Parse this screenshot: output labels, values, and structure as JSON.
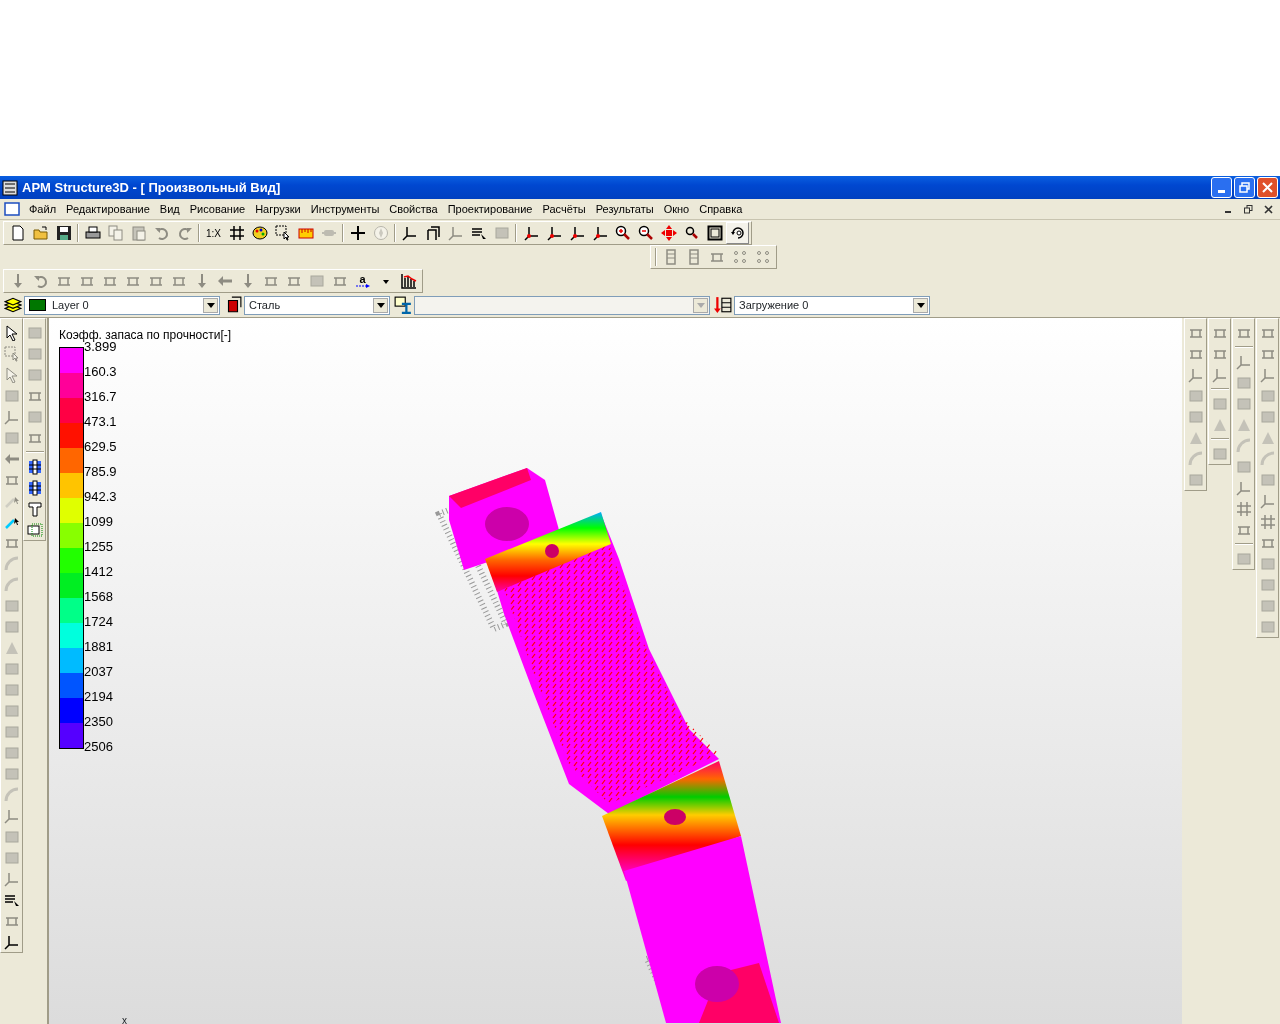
{
  "window": {
    "title": "APM Structure3D - [ Произвольный Вид]"
  },
  "menu": [
    "Файл",
    "Редактирование",
    "Вид",
    "Рисование",
    "Нагрузки",
    "Инструменты",
    "Свойства",
    "Проектирование",
    "Расчёты",
    "Результаты",
    "Окно",
    "Справка"
  ],
  "toolbars": [
    {
      "buttons": [
        {
          "kind": "button",
          "disabled": false,
          "pressed": false
        },
        {
          "kind": "button",
          "disabled": false,
          "pressed": false
        },
        {
          "kind": "button",
          "disabled": false,
          "pressed": false
        },
        {
          "kind": "separator"
        },
        {
          "kind": "button",
          "disabled": false,
          "pressed": false
        },
        {
          "kind": "button",
          "disabled": true,
          "pressed": false
        },
        {
          "kind": "button",
          "disabled": true,
          "pressed": false
        },
        {
          "kind": "button",
          "disabled": true,
          "pressed": false
        },
        {
          "kind": "button",
          "disabled": true,
          "pressed": false
        },
        {
          "kind": "separator"
        },
        {
          "kind": "text",
          "label": "1:X",
          "disabled": false,
          "pressed": false
        },
        {
          "kind": "button",
          "disabled": false,
          "pressed": false
        },
        {
          "kind": "button",
          "disabled": false,
          "pressed": false
        },
        {
          "kind": "button",
          "disabled": false,
          "pressed": false
        },
        {
          "kind": "button",
          "disabled": false,
          "pressed": false
        },
        {
          "kind": "button",
          "disabled": true,
          "pressed": false
        },
        {
          "kind": "separator"
        },
        {
          "kind": "button",
          "disabled": false,
          "pressed": false
        },
        {
          "kind": "button",
          "disabled": true,
          "pressed": false
        },
        {
          "kind": "separator"
        },
        {
          "kind": "button",
          "disabled": false,
          "pressed": false
        },
        {
          "kind": "button",
          "disabled": false,
          "pressed": false
        },
        {
          "kind": "button",
          "disabled": true,
          "pressed": false
        },
        {
          "kind": "button",
          "disabled": false,
          "pressed": false
        },
        {
          "kind": "button",
          "disabled": true,
          "pressed": false
        },
        {
          "kind": "separator"
        },
        {
          "kind": "button",
          "disabled": false,
          "pressed": false
        },
        {
          "kind": "button",
          "disabled": false,
          "pressed": false
        },
        {
          "kind": "button",
          "disabled": false,
          "pressed": false
        },
        {
          "kind": "button",
          "disabled": false,
          "pressed": false
        },
        {
          "kind": "button",
          "disabled": false,
          "pressed": false
        },
        {
          "kind": "button",
          "disabled": false,
          "pressed": false
        },
        {
          "kind": "button",
          "disabled": false,
          "pressed": false
        },
        {
          "kind": "button",
          "disabled": false,
          "pressed": false
        },
        {
          "kind": "button",
          "disabled": false,
          "pressed": false
        },
        {
          "kind": "button",
          "disabled": false,
          "pressed": true
        }
      ]
    },
    {
      "buttons": [
        {
          "kind": "separator"
        },
        {
          "kind": "button",
          "disabled": true
        },
        {
          "kind": "button",
          "disabled": true
        },
        {
          "kind": "button",
          "disabled": true
        },
        {
          "kind": "button",
          "disabled": true
        },
        {
          "kind": "button",
          "disabled": true
        }
      ]
    },
    {
      "buttons": [
        {
          "kind": "button",
          "disabled": true
        },
        {
          "kind": "button",
          "disabled": true
        },
        {
          "kind": "button",
          "disabled": true
        },
        {
          "kind": "button",
          "disabled": true
        },
        {
          "kind": "button",
          "disabled": true
        },
        {
          "kind": "button",
          "disabled": true
        },
        {
          "kind": "button",
          "disabled": true
        },
        {
          "kind": "button",
          "disabled": true
        },
        {
          "kind": "button",
          "disabled": true
        },
        {
          "kind": "button",
          "disabled": true
        },
        {
          "kind": "button",
          "disabled": true
        },
        {
          "kind": "button",
          "disabled": true
        },
        {
          "kind": "button",
          "disabled": true
        },
        {
          "kind": "button",
          "disabled": true
        },
        {
          "kind": "button",
          "disabled": true
        },
        {
          "kind": "text",
          "label": "a",
          "disabled": false
        },
        {
          "kind": "button",
          "disabled": false
        },
        {
          "kind": "button",
          "disabled": false
        }
      ]
    }
  ],
  "property_bar": {
    "layer": {
      "value": "Layer 0",
      "color": "#007700"
    },
    "material": {
      "value": "Сталь"
    },
    "section": {
      "disabled": true
    },
    "load_case": {
      "value": "Загружение 0"
    }
  },
  "side_toolbars": [
    {
      "buttons": [
        {
          "kind": "button",
          "disabled": false
        },
        {
          "kind": "button",
          "disabled": true
        },
        {
          "kind": "button",
          "disabled": true
        },
        {
          "kind": "button",
          "disabled": true
        },
        {
          "kind": "button",
          "disabled": true
        },
        {
          "kind": "button",
          "disabled": true
        },
        {
          "kind": "button",
          "disabled": true
        },
        {
          "kind": "button",
          "disabled": true
        },
        {
          "kind": "button",
          "disabled": true
        },
        {
          "kind": "button",
          "disabled": false
        },
        {
          "kind": "button",
          "disabled": true
        },
        {
          "kind": "button",
          "disabled": true
        },
        {
          "kind": "button",
          "disabled": true
        },
        {
          "kind": "button",
          "disabled": true
        },
        {
          "kind": "button",
          "disabled": true
        },
        {
          "kind": "button",
          "disabled": true
        },
        {
          "kind": "button",
          "disabled": true
        },
        {
          "kind": "button",
          "disabled": true
        },
        {
          "kind": "button",
          "disabled": true
        },
        {
          "kind": "button",
          "disabled": true
        },
        {
          "kind": "button",
          "disabled": true
        },
        {
          "kind": "button",
          "disabled": true
        },
        {
          "kind": "button",
          "disabled": true
        },
        {
          "kind": "button",
          "disabled": true
        },
        {
          "kind": "button",
          "disabled": true
        },
        {
          "kind": "button",
          "disabled": true
        },
        {
          "kind": "button",
          "disabled": true
        },
        {
          "kind": "button",
          "disabled": false
        },
        {
          "kind": "button",
          "disabled": true
        },
        {
          "kind": "button",
          "disabled": false
        }
      ]
    },
    {
      "buttons": [
        {
          "kind": "button",
          "disabled": true
        },
        {
          "kind": "button",
          "disabled": true
        },
        {
          "kind": "button",
          "disabled": true
        },
        {
          "kind": "button",
          "disabled": true
        },
        {
          "kind": "button",
          "disabled": true
        },
        {
          "kind": "button",
          "disabled": true
        },
        {
          "kind": "separator"
        },
        {
          "kind": "button",
          "disabled": false
        },
        {
          "kind": "button",
          "disabled": false
        },
        {
          "kind": "button",
          "disabled": false
        },
        {
          "kind": "button",
          "disabled": false
        }
      ]
    },
    {
      "buttons": [
        {
          "kind": "button",
          "disabled": true
        },
        {
          "kind": "button",
          "disabled": true
        },
        {
          "kind": "button",
          "disabled": true
        },
        {
          "kind": "button",
          "disabled": true
        },
        {
          "kind": "button",
          "disabled": true
        },
        {
          "kind": "button",
          "disabled": true
        },
        {
          "kind": "button",
          "disabled": true
        },
        {
          "kind": "button",
          "disabled": true
        }
      ]
    },
    {
      "buttons": [
        {
          "kind": "button",
          "disabled": true
        },
        {
          "kind": "button",
          "disabled": true
        },
        {
          "kind": "button",
          "disabled": true
        },
        {
          "kind": "separator"
        },
        {
          "kind": "button",
          "disabled": true
        },
        {
          "kind": "button",
          "disabled": true
        },
        {
          "kind": "separator"
        },
        {
          "kind": "button",
          "disabled": true
        }
      ]
    },
    {
      "buttons": [
        {
          "kind": "button",
          "disabled": true
        },
        {
          "kind": "separator"
        },
        {
          "kind": "button",
          "disabled": true
        },
        {
          "kind": "button",
          "disabled": true
        },
        {
          "kind": "button",
          "disabled": true
        },
        {
          "kind": "button",
          "disabled": true
        },
        {
          "kind": "button",
          "disabled": true
        },
        {
          "kind": "button",
          "disabled": true
        },
        {
          "kind": "button",
          "disabled": true
        },
        {
          "kind": "button",
          "disabled": true
        },
        {
          "kind": "button",
          "disabled": true
        },
        {
          "kind": "separator"
        },
        {
          "kind": "button",
          "disabled": true
        }
      ]
    },
    {
      "buttons": [
        {
          "kind": "button",
          "disabled": true
        },
        {
          "kind": "button",
          "disabled": true
        },
        {
          "kind": "button",
          "disabled": true
        },
        {
          "kind": "button",
          "disabled": true
        },
        {
          "kind": "button",
          "disabled": true
        },
        {
          "kind": "button",
          "disabled": true
        },
        {
          "kind": "button",
          "disabled": true
        },
        {
          "kind": "button",
          "disabled": true
        },
        {
          "kind": "button",
          "disabled": true
        },
        {
          "kind": "button",
          "disabled": true
        },
        {
          "kind": "button",
          "disabled": true
        },
        {
          "kind": "button",
          "disabled": true
        },
        {
          "kind": "button",
          "disabled": true
        },
        {
          "kind": "button",
          "disabled": true
        },
        {
          "kind": "button",
          "disabled": true
        }
      ]
    }
  ],
  "legend": {
    "title": "Коэфф. запаса по прочности[-]",
    "bands": [
      {
        "color": "#ff00ff"
      },
      {
        "color": "#ff0099"
      },
      {
        "color": "#ff0044"
      },
      {
        "color": "#ff1100"
      },
      {
        "color": "#ff6600"
      },
      {
        "color": "#ffc400"
      },
      {
        "color": "#e0ff00"
      },
      {
        "color": "#88ff00"
      },
      {
        "color": "#22ff00"
      },
      {
        "color": "#00ee22"
      },
      {
        "color": "#00ff88"
      },
      {
        "color": "#00ffdd"
      },
      {
        "color": "#00bbff"
      },
      {
        "color": "#0055ff"
      },
      {
        "color": "#0000ff"
      },
      {
        "color": "#5500ff"
      }
    ],
    "ticks": [
      "3.899",
      "160.3",
      "316.7",
      "473.1",
      "629.5",
      "785.9",
      "942.3",
      "1099",
      "1255",
      "1412",
      "1568",
      "1724",
      "1881",
      "2037",
      "2194",
      "2350",
      "2506"
    ]
  },
  "axis_label": "x"
}
